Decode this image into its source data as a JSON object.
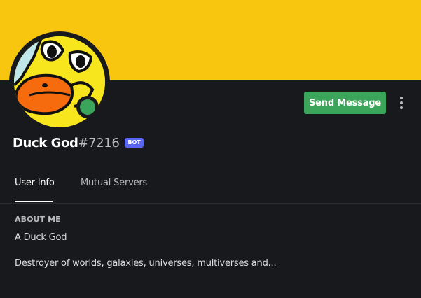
{
  "profile": {
    "username": "Duck God",
    "discriminator": "#7216",
    "bot_tag": "BOT",
    "status": "online",
    "avatar_icon": "duck-avatar-icon"
  },
  "actions": {
    "send_message_label": "Send Message",
    "more_icon": "vertical-ellipsis-icon"
  },
  "tabs": [
    {
      "label": "User Info",
      "active": true
    },
    {
      "label": "Mutual Servers",
      "active": false
    }
  ],
  "about": {
    "title": "ABOUT ME",
    "lines": [
      "A Duck God",
      "Destroyer of worlds, galaxies, universes, multiverses and..."
    ]
  },
  "colors": {
    "banner": "#f8c60f",
    "background": "#18191c",
    "send_button": "#3ba55c",
    "status_online": "#3ba55c",
    "bot_tag": "#5865f2"
  }
}
